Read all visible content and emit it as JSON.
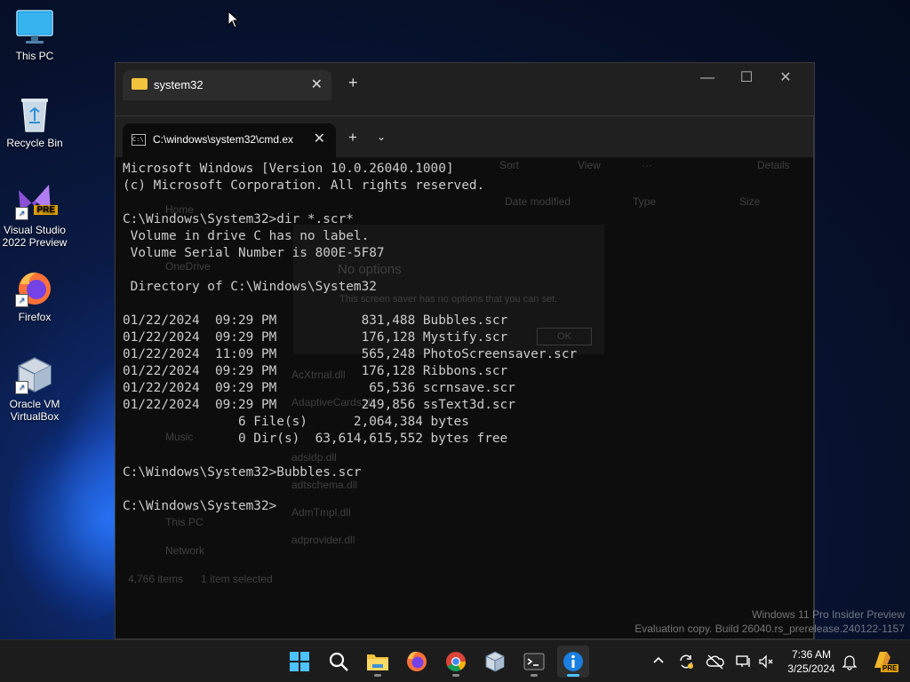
{
  "desktop": {
    "icons": [
      {
        "label": "This PC"
      },
      {
        "label": "Recycle Bin"
      },
      {
        "label": "Visual Studio 2022 Preview",
        "badge": "PRE"
      },
      {
        "label": "Firefox"
      },
      {
        "label": "Oracle VM VirtualBox"
      }
    ]
  },
  "explorer": {
    "tab_title": "system32",
    "faint": {
      "toolbar": [
        "Sort",
        "View",
        "···",
        "Details"
      ],
      "columns": [
        "Date modified",
        "Type",
        "Size"
      ],
      "nav": [
        "Home",
        "OneDrive",
        "Music",
        "This PC",
        "Network"
      ],
      "files": [
        "AcXtrnal.dll",
        "AdaptiveCards.dll",
        "adsldp.dll",
        "adtschema.dll",
        "AdmTmpl.dll",
        "adprovider.dll"
      ],
      "status": [
        "4,766 items",
        "1 item selected"
      ],
      "dialog_title": "No options",
      "dialog_text": "This screen saver has no options that you can set.",
      "dialog_ok": "OK"
    }
  },
  "terminal": {
    "tab_title": "C:\\windows\\system32\\cmd.ex",
    "lines": [
      "Microsoft Windows [Version 10.0.26040.1000]",
      "(c) Microsoft Corporation. All rights reserved.",
      "",
      "C:\\Windows\\System32>dir *.scr*",
      " Volume in drive C has no label.",
      " Volume Serial Number is 800E-5F87",
      "",
      " Directory of C:\\Windows\\System32",
      "",
      "01/22/2024  09:29 PM           831,488 Bubbles.scr",
      "01/22/2024  09:29 PM           176,128 Mystify.scr",
      "01/22/2024  11:09 PM           565,248 PhotoScreensaver.scr",
      "01/22/2024  09:29 PM           176,128 Ribbons.scr",
      "01/22/2024  09:29 PM            65,536 scrnsave.scr",
      "01/22/2024  09:29 PM           249,856 ssText3d.scr",
      "               6 File(s)      2,064,384 bytes",
      "               0 Dir(s)  63,614,615,552 bytes free",
      "",
      "C:\\Windows\\System32>Bubbles.scr",
      "",
      "C:\\Windows\\System32>"
    ]
  },
  "watermark": {
    "line1": "Windows 11 Pro Insider Preview",
    "line2": "Evaluation copy. Build 26040.rs_prerelease.240122-1157"
  },
  "taskbar": {
    "time": "7:36 AM",
    "date": "3/25/2024",
    "copilot_badge": "PRE"
  },
  "colors": {
    "terminal_text": "#cccccc",
    "accent": "#4cc2ff",
    "folder": "#f3c33c"
  }
}
